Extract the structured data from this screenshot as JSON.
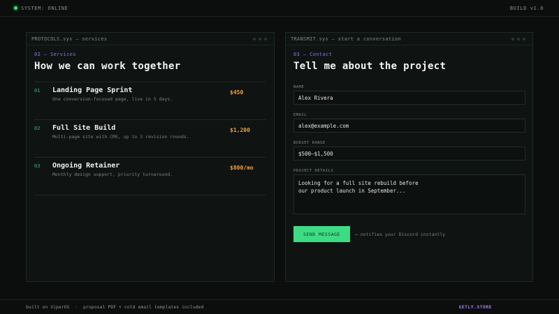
{
  "topbar": {
    "status": "SYSTEM: ONLINE",
    "build": "BUILD v1.0"
  },
  "services_panel": {
    "window_title": "PROTOCOLS.sys — services",
    "tag": "02 — Services",
    "title": "How we can work together",
    "items": [
      {
        "num": "01",
        "name": "Landing Page Sprint",
        "desc": "One conversion-focused page, live in 5 days.",
        "price": "$450"
      },
      {
        "num": "02",
        "name": "Full Site Build",
        "desc": "Multi-page site with CMS, up to 3 revision rounds.",
        "price": "$1,200"
      },
      {
        "num": "03",
        "name": "Ongoing Retainer",
        "desc": "Monthly design support, priority turnaround.",
        "price": "$800/mo"
      }
    ]
  },
  "contact_panel": {
    "window_title": "TRANSMIT.sys — start a conversation",
    "tag": "03 — Contact",
    "title": "Tell me about the project",
    "name_label": "NAME",
    "name_value": "Alex Rivera",
    "email_label": "EMAIL",
    "email_value": "alex@example.com",
    "budget_label": "BUDGET RANGE",
    "budget_value": "$500–$1,500",
    "details_label": "PROJECT DETAILS",
    "details_value": "Looking for a full site rebuild before\nour product launch in September...",
    "send_label": "SEND MESSAGE",
    "send_note": "→ notifies your Discord instantly"
  },
  "footer": {
    "credits": "built on ViperOS  ·  proposal PDF + cold email templates included",
    "brand": "GETLY.STORE"
  },
  "colors": {
    "accent_green": "#3ddc84",
    "accent_purple": "#9b6cf0",
    "price_orange": "#f4a13a"
  }
}
